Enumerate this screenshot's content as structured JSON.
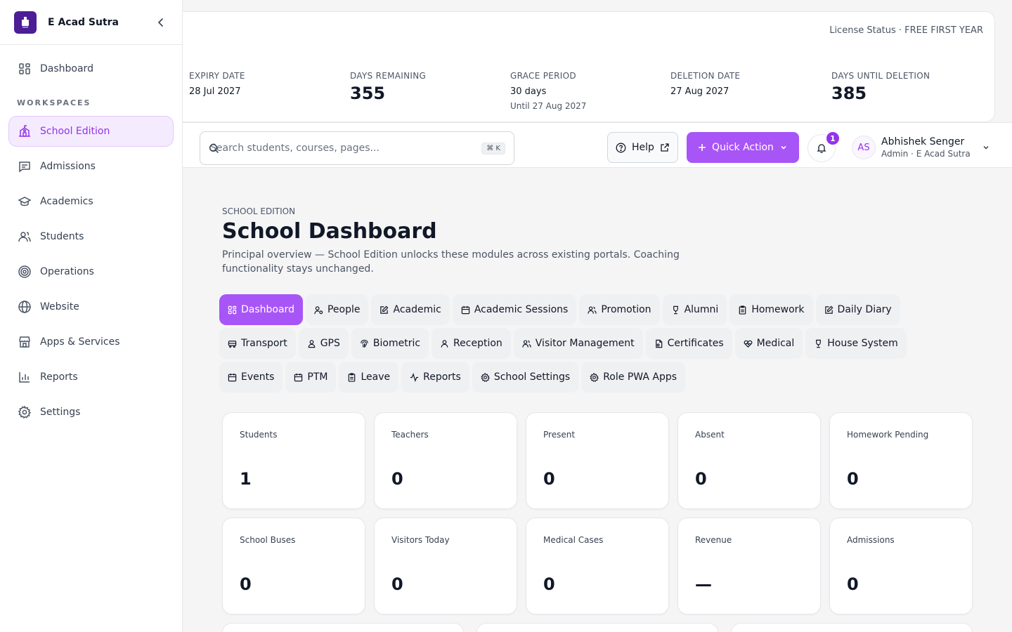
{
  "brand": {
    "name": "E Acad Sutra",
    "logo_text": "E Acad Sutra"
  },
  "sidebar": {
    "section_label": "WORKSPACES",
    "top_item": {
      "label": "Dashboard",
      "icon": "grid-icon"
    },
    "items": [
      {
        "label": "School Edition",
        "icon": "school-icon",
        "active": true
      },
      {
        "label": "Admissions",
        "icon": "message-square-icon"
      },
      {
        "label": "Academics",
        "icon": "graduation-cap-icon"
      },
      {
        "label": "Students",
        "icon": "users-icon"
      },
      {
        "label": "Operations",
        "icon": "target-icon"
      },
      {
        "label": "Website",
        "icon": "globe-icon"
      },
      {
        "label": "Apps & Services",
        "icon": "store-icon"
      },
      {
        "label": "Reports",
        "icon": "bar-chart-icon"
      },
      {
        "label": "Settings",
        "icon": "gear-icon"
      }
    ]
  },
  "license": {
    "status": "License Status · FREE FIRST YEAR",
    "expiry_label": "EXPIRY DATE",
    "expiry_value": "28 Jul 2027",
    "days_remaining_label": "DAYS REMAINING",
    "days_remaining_value": "355",
    "grace_label": "GRACE PERIOD",
    "grace_value": "30 days",
    "grace_sub": "Until 27 Aug 2027",
    "deletion_label": "DELETION DATE",
    "deletion_value": "27 Aug 2027",
    "days_until_deletion_label": "DAYS UNTIL DELETION",
    "days_until_deletion_value": "385"
  },
  "topbar": {
    "search_placeholder": "Search students, courses, pages...",
    "search_shortcut": "⌘ K",
    "help_label": "Help",
    "quick_action_label": "Quick Action",
    "notification_count": "1",
    "user": {
      "initials": "AS",
      "name": "Abhishek Senger",
      "role": "Admin · E Acad Sutra"
    }
  },
  "page": {
    "eyebrow": "SCHOOL EDITION",
    "title": "School Dashboard",
    "description": "Principal overview — School Edition unlocks these modules across existing portals. Coaching functionality stays unchanged."
  },
  "tabs": [
    {
      "label": "Dashboard",
      "icon": "grid-icon",
      "active": true
    },
    {
      "label": "People",
      "icon": "user-gear-icon"
    },
    {
      "label": "Academic",
      "icon": "edit-icon"
    },
    {
      "label": "Academic Sessions",
      "icon": "calendar-icon"
    },
    {
      "label": "Promotion",
      "icon": "users-icon"
    },
    {
      "label": "Alumni",
      "icon": "trophy-icon"
    },
    {
      "label": "Homework",
      "icon": "clipboard-icon"
    },
    {
      "label": "Daily Diary",
      "icon": "edit-icon"
    },
    {
      "label": "Transport",
      "icon": "bus-icon"
    },
    {
      "label": "GPS",
      "icon": "user-pin-icon"
    },
    {
      "label": "Biometric",
      "icon": "fingerprint-icon"
    },
    {
      "label": "Reception",
      "icon": "user-icon"
    },
    {
      "label": "Visitor Management",
      "icon": "users-icon"
    },
    {
      "label": "Certificates",
      "icon": "file-icon"
    },
    {
      "label": "Medical",
      "icon": "heart-icon"
    },
    {
      "label": "House System",
      "icon": "trophy-icon"
    },
    {
      "label": "Events",
      "icon": "calendar-icon"
    },
    {
      "label": "PTM",
      "icon": "calendar-icon"
    },
    {
      "label": "Leave",
      "icon": "clipboard-icon"
    },
    {
      "label": "Reports",
      "icon": "activity-icon"
    },
    {
      "label": "School Settings",
      "icon": "gear-icon"
    },
    {
      "label": "Role PWA Apps",
      "icon": "gear-icon"
    }
  ],
  "stats": [
    {
      "label": "Students",
      "value": "1"
    },
    {
      "label": "Teachers",
      "value": "0"
    },
    {
      "label": "Present",
      "value": "0"
    },
    {
      "label": "Absent",
      "value": "0"
    },
    {
      "label": "Homework Pending",
      "value": "0"
    },
    {
      "label": "School Buses",
      "value": "0"
    },
    {
      "label": "Visitors Today",
      "value": "0"
    },
    {
      "label": "Medical Cases",
      "value": "0"
    },
    {
      "label": "Revenue",
      "value": "—"
    },
    {
      "label": "Admissions",
      "value": "0"
    }
  ],
  "colors": {
    "accent": "#a855f7",
    "accent_dark": "#9333ea",
    "active_bg": "#f5ebfe",
    "logo_bg": "#4c1d95"
  }
}
